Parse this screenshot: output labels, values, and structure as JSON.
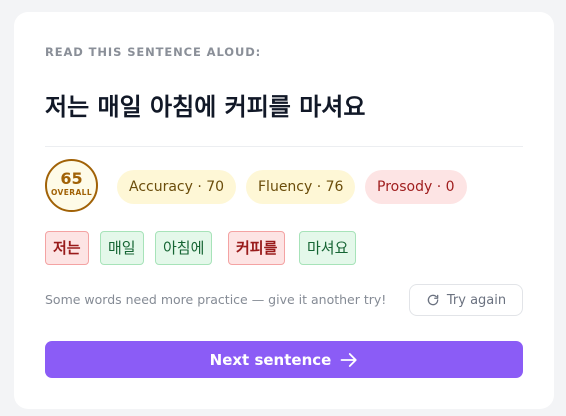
{
  "prompt": {
    "label": "READ THIS SENTENCE ALOUD:",
    "sentence": "저는 매일 아침에 커피를 마셔요"
  },
  "scores": {
    "overall": {
      "value": "65",
      "label": "OVERALL"
    },
    "metrics": [
      {
        "label": "Accuracy · 70",
        "status": "warn"
      },
      {
        "label": "Fluency · 76",
        "status": "warn"
      },
      {
        "label": "Prosody · 0",
        "status": "bad"
      }
    ]
  },
  "words": [
    {
      "text": "저는",
      "status": "bad"
    },
    {
      "text": "매일",
      "status": "good"
    },
    {
      "text": "아침에",
      "status": "good"
    },
    {
      "text": "커피를",
      "status": "bad"
    },
    {
      "text": "마셔요",
      "status": "good"
    }
  ],
  "feedback": {
    "message": "Some words need more practice — give it another try!",
    "retry_label": "Try again"
  },
  "actions": {
    "next_label": "Next sentence"
  },
  "colors": {
    "accent": "#8b5cf6",
    "good_bg": "#e4f8ea",
    "bad_bg": "#fde4e4",
    "warn_bg": "#fef7d6"
  },
  "icons": {
    "retry": "refresh-icon",
    "next": "arrow-right-icon"
  }
}
